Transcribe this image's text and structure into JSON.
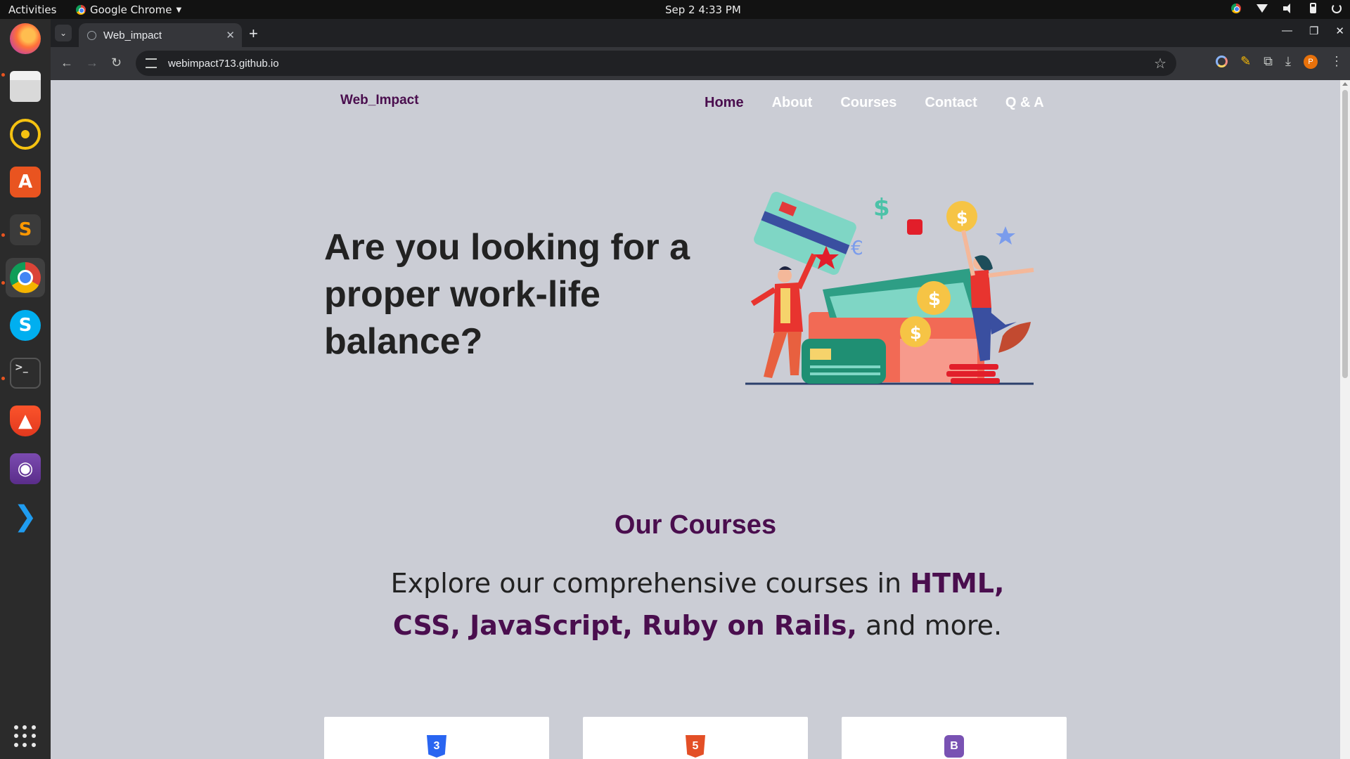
{
  "system": {
    "activities": "Activities",
    "app_name": "Google Chrome",
    "clock": "Sep 2  4:33 PM"
  },
  "dock": {
    "apps": [
      "firefox",
      "files",
      "rhythmbox",
      "app-center",
      "sublime-text",
      "google-chrome",
      "skype",
      "terminal",
      "brave",
      "video-editor",
      "vscode"
    ]
  },
  "browser": {
    "tab_title": "Web_impact",
    "url": "webimpact713.github.io",
    "avatar_letter": "P"
  },
  "site": {
    "brand": "Web_Impact",
    "nav": {
      "home": "Home",
      "about": "About",
      "courses": "Courses",
      "contact": "Contact",
      "qa": "Q & A"
    },
    "hero_text": "Are you looking for a proper work-life balance?",
    "courses_title": "Our Courses",
    "courses_desc": {
      "prefix": "Explore our comprehensive courses in ",
      "highlight": "HTML, CSS, JavaScript, Ruby on Rails,",
      "suffix": " and more."
    },
    "cards": [
      {
        "icon": "css3-icon",
        "glyph": "3",
        "color": "#2965f1"
      },
      {
        "icon": "html5-icon",
        "glyph": "5",
        "color": "#e34f26"
      },
      {
        "icon": "bootstrap-icon",
        "glyph": "B",
        "color": "#7952b3"
      }
    ]
  },
  "colors": {
    "brand": "#4a0e4e",
    "page_bg": "#cbcdd5",
    "nav_link": "#ffffff"
  }
}
